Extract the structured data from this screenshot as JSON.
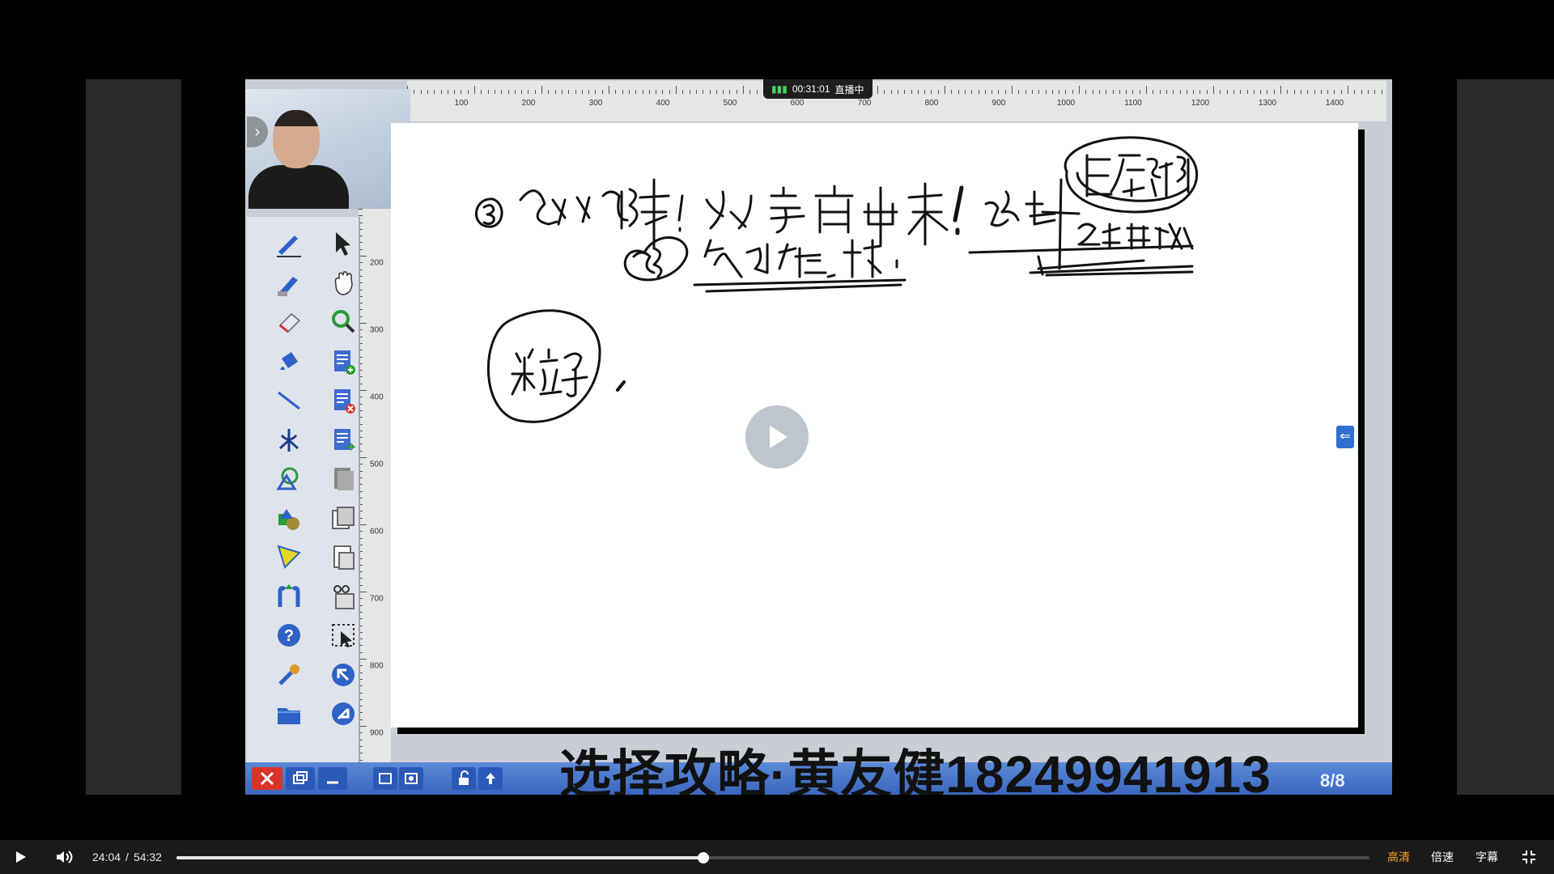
{
  "live": {
    "time": "00:31:01",
    "status": "直播中"
  },
  "rulers": {
    "top_labels": [
      "100",
      "200",
      "300",
      "400",
      "500",
      "600",
      "700",
      "800",
      "900",
      "1000",
      "1100",
      "1200",
      "1300",
      "1400"
    ],
    "left_labels": [
      "200",
      "300",
      "400",
      "500",
      "600",
      "700",
      "800",
      "900"
    ]
  },
  "watermark": "选择攻略·黄友健18249941913",
  "page_indicator": "8/8",
  "controls": {
    "time_current": "24:04",
    "time_separator": "/",
    "time_total": "54:32",
    "progress_fraction": 0.4415,
    "quality": "高清",
    "speed": "倍速",
    "subtitles": "字幕"
  },
  "colors": {
    "quality_accent": "#f5a623",
    "toolbar_blue": "#3a66be",
    "live_green": "#46d160"
  },
  "tools": [
    {
      "name": "pen-icon"
    },
    {
      "name": "pointer-icon"
    },
    {
      "name": "highlighter-icon"
    },
    {
      "name": "hand-icon"
    },
    {
      "name": "eraser-icon"
    },
    {
      "name": "zoom-icon"
    },
    {
      "name": "fill-bucket-icon"
    },
    {
      "name": "add-page-icon"
    },
    {
      "name": "line-icon"
    },
    {
      "name": "delete-page-icon"
    },
    {
      "name": "compass-icon"
    },
    {
      "name": "next-page-icon"
    },
    {
      "name": "shapes-icon"
    },
    {
      "name": "copy-page-icon"
    },
    {
      "name": "solid-shapes-icon"
    },
    {
      "name": "duplicate-icon"
    },
    {
      "name": "triangle-ruler-icon"
    },
    {
      "name": "paste-icon"
    },
    {
      "name": "magnet-icon"
    },
    {
      "name": "cut-icon"
    },
    {
      "name": "help-icon"
    },
    {
      "name": "select-area-icon"
    },
    {
      "name": "settings-wrench-icon"
    },
    {
      "name": "undo-icon"
    },
    {
      "name": "folder-icon"
    },
    {
      "name": "redo-icon"
    }
  ]
}
